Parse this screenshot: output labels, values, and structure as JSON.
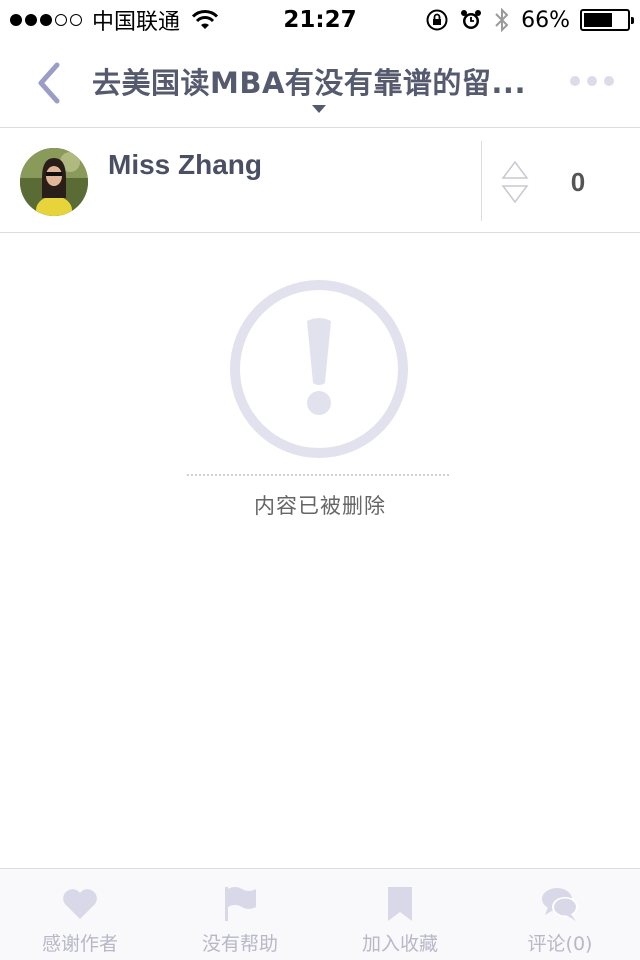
{
  "status_bar": {
    "carrier": "中国联通",
    "time": "21:27",
    "battery": "66%",
    "battery_level": 0.66,
    "signal_strength": 3
  },
  "nav": {
    "title": "去美国读MBA有没有靠谱的留...",
    "back_icon": "chevron-left-icon",
    "more_icon": "ellipsis-icon"
  },
  "author": {
    "name": "Miss Zhang",
    "vote_count": "0"
  },
  "content": {
    "deleted_message": "内容已被删除",
    "icon": "exclamation-circle-icon"
  },
  "tabs": [
    {
      "label": "感谢作者",
      "icon": "heart-icon"
    },
    {
      "label": "没有帮助",
      "icon": "flag-icon"
    },
    {
      "label": "加入收藏",
      "icon": "bookmark-icon"
    },
    {
      "label": "评论(0)",
      "icon": "comment-icon"
    }
  ],
  "colors": {
    "accent": "#8e8fc0",
    "icon_gray": "#e2e2ee",
    "tab_icon": "#d8d8e8",
    "tab_label": "#b8b8c8"
  }
}
